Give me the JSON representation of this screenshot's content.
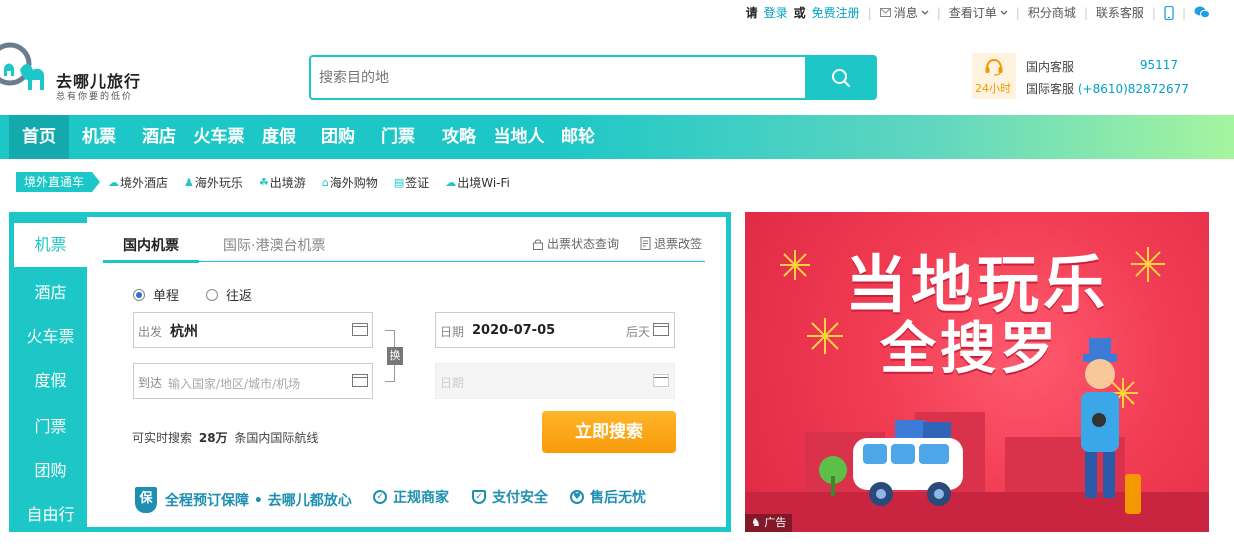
{
  "topbar": {
    "please": "请",
    "login": "登录",
    "or": "或",
    "register": "免费注册",
    "messages": "消息",
    "orders": "查看订单",
    "points": "积分商城",
    "support": "联系客服"
  },
  "logo": {
    "title": "去哪儿旅行",
    "slogan": "总有你要的低价"
  },
  "search": {
    "placeholder": "搜索目的地"
  },
  "service": {
    "badge": "24小时",
    "domestic_label": "国内客服",
    "domestic_num": "95117",
    "intl_label": "国际客服",
    "intl_num": "(+8610)82872677"
  },
  "nav": [
    "首页",
    "机票",
    "酒店",
    "火车票",
    "度假",
    "团购",
    "门票",
    "攻略",
    "当地人",
    "邮轮"
  ],
  "subnav": {
    "first": "境外直通车",
    "items": [
      "境外酒店",
      "海外玩乐",
      "出境游",
      "海外购物",
      "签证",
      "出境Wi-Fi"
    ]
  },
  "booking": {
    "side": [
      "机票",
      "酒店",
      "火车票",
      "度假",
      "门票",
      "团购",
      "自由行"
    ],
    "tabs": [
      "国内机票",
      "国际·港澳台机票"
    ],
    "tools": [
      "出票状态查询",
      "退票改签"
    ],
    "trip_types": [
      "单程",
      "往返"
    ],
    "from_label": "出发",
    "from_value": "杭州",
    "to_label": "到达",
    "to_placeholder": "输入国家/地区/城市/机场",
    "date_label": "日期",
    "date_value": "2020-07-05",
    "date_hint": "后天",
    "return_label": "日期",
    "swap": "换",
    "info_prefix": "可实时搜索",
    "info_count": "28万",
    "info_suffix": "条国内国际航线",
    "search_btn": "立即搜索",
    "guarantee_main": "全程预订保障 • 去哪儿都放心",
    "guarantee_items": [
      "正规商家",
      "支付安全",
      "售后无忧"
    ],
    "shield": "保"
  },
  "ad": {
    "line1": "当地玩乐",
    "line2": "全搜罗",
    "label": "广告"
  },
  "colors": {
    "accent": "#1ec7c7",
    "orange": "#f89b09",
    "link": "#00a0c8"
  }
}
